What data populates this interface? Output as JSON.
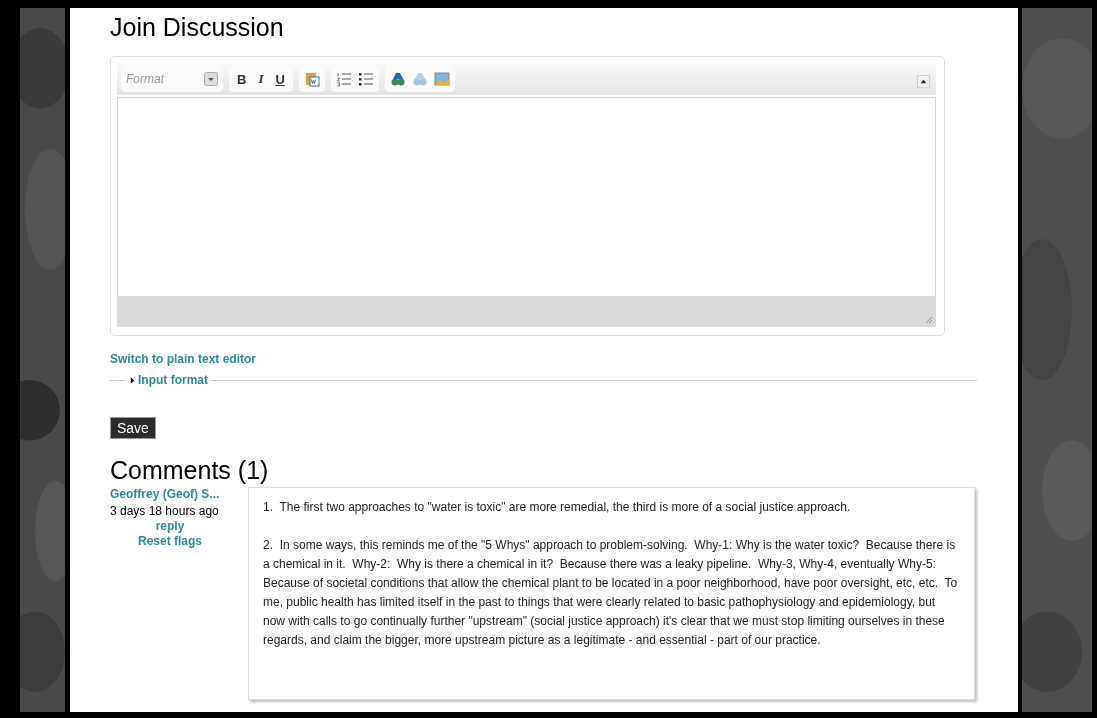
{
  "heading": "Join Discussion",
  "editor": {
    "format_placeholder": "Format",
    "text_buttons": [
      {
        "kind": "bold",
        "label": "B"
      },
      {
        "kind": "italic",
        "label": "I"
      },
      {
        "kind": "underline",
        "label": "U"
      }
    ]
  },
  "switch_link": "Switch to plain text editor",
  "input_format": {
    "label": "Input format",
    "expanded": false
  },
  "save_button": "Save",
  "comments_heading": "Comments (1)",
  "comments": [
    {
      "author": "Geoffrey (Geof) S...",
      "time": "3 days 18 hours ago",
      "actions": [
        "reply",
        "Reset flags"
      ],
      "paragraphs": [
        "1.  The first two approaches to \"water is toxic\" are more remedial, the third is more of a social justice approach.",
        "2.  In some ways, this reminds me of the \"5 Whys\" approach to problem-solving.  Why-1: Why is the water toxic?  Because there is a chemical in it.  Why-2:  Why is there a chemical in it?  Because there was a leaky pipeline.  Why-3, Why-4, eventually Why-5:  Because of societal conditions that allow the chemical plant to be located in a poor neighborhood, have poor oversight, etc, etc.  To me, public health has limited itself in the past to things that were clearly related to basic pathophysiology and epidemiology, but now with calls to go continually further \"upstream\" (social justice approach) it's clear that we must stop limiting ourselves in these regards, and claim the bigger, more upstream picture as a legitimate - and essential - part of our practice."
      ]
    }
  ]
}
